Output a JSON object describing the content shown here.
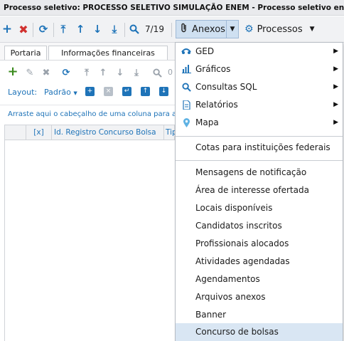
{
  "window": {
    "title": "Processo seletivo: PROCESSO SELETIVO SIMULAÇÃO ENEM - Processo seletivo encerrad"
  },
  "toolbar": {
    "icons": [
      "add-icon",
      "delete-icon",
      "refresh-icon",
      "first-icon",
      "up-icon",
      "down-icon",
      "last-icon",
      "search-icon"
    ],
    "pager": "7/19",
    "anexos_label": "Anexos",
    "processos_label": "Processos"
  },
  "tabs": [
    {
      "label": "Portaria"
    },
    {
      "label": "Informações financeiras"
    }
  ],
  "grid": {
    "layout_label": "Layout:",
    "layout_value": "Padrão",
    "search_value": "0",
    "group_hint": "Arraste aqui o cabeçalho de uma coluna para agr",
    "columns": [
      "[x]",
      "Id. Registro Concurso Bolsa",
      "Tipo"
    ]
  },
  "menu": {
    "group1": [
      {
        "label": "GED",
        "icon": "ged-icon",
        "submenu": true
      },
      {
        "label": "Gráficos",
        "icon": "chart-icon",
        "submenu": true
      },
      {
        "label": "Consultas SQL",
        "icon": "search-icon",
        "submenu": true
      },
      {
        "label": "Relatórios",
        "icon": "report-icon",
        "submenu": true
      },
      {
        "label": "Mapa",
        "icon": "map-pin-icon",
        "submenu": true
      }
    ],
    "group2": [
      {
        "label": "Cotas para instituições federais"
      }
    ],
    "group3": [
      {
        "label": "Mensagens de notificação"
      },
      {
        "label": "Área de interesse ofertada"
      },
      {
        "label": "Locais disponíveis"
      },
      {
        "label": "Candidatos inscritos"
      },
      {
        "label": "Profissionais alocados"
      },
      {
        "label": "Atividades agendadas"
      },
      {
        "label": "Agendamentos"
      },
      {
        "label": "Arquivos anexos"
      },
      {
        "label": "Banner"
      },
      {
        "label": "Concurso de bolsas"
      }
    ]
  },
  "colors": {
    "accent": "#1e73b8",
    "highlight_add": "#f5ef3b",
    "menu_selected": "#d9e6f3"
  }
}
